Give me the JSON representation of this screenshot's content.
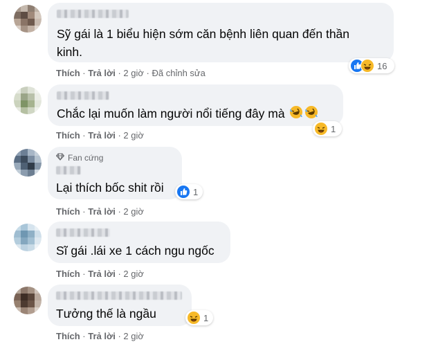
{
  "comments": [
    {
      "text_lines": [
        "Sỹ gái là 1 biểu hiện sớm căn bệnh liên quan đến thần",
        "kinh."
      ],
      "actions": {
        "like": "Thích",
        "reply": "Trả lời",
        "time": "2 giờ",
        "edited": "Đã chỉnh sửa"
      },
      "reactions": {
        "icons": [
          "like-icon",
          "haha-icon"
        ],
        "count": "16"
      }
    },
    {
      "text_lines": [
        "Chắc lại muốn làm người nổi tiếng đây mà"
      ],
      "inline_emojis": [
        "rofl-emoji",
        "rofl-emoji"
      ],
      "actions": {
        "like": "Thích",
        "reply": "Trả lời",
        "time": "2 giờ"
      },
      "reactions": {
        "icons": [
          "haha-icon"
        ],
        "count": "1"
      }
    },
    {
      "badge": "Fan cứng",
      "badge_icon": "diamond-icon",
      "text_lines": [
        "Lại thích bốc shit rồi"
      ],
      "actions": {
        "like": "Thích",
        "reply": "Trả lời",
        "time": "2 giờ"
      },
      "reactions": {
        "icons": [
          "like-icon"
        ],
        "count": "1"
      }
    },
    {
      "text_lines": [
        "Sĩ gái .lái xe 1 cách ngu ngốc"
      ],
      "actions": {
        "like": "Thích",
        "reply": "Trả lời",
        "time": "2 giờ"
      }
    },
    {
      "text_lines": [
        "Tưởng thế là ngầu"
      ],
      "actions": {
        "like": "Thích",
        "reply": "Trả lời",
        "time": "2 giờ"
      },
      "reactions": {
        "icons": [
          "haha-icon"
        ],
        "count": "1"
      }
    }
  ],
  "colors": {
    "bubble": "#f0f2f5",
    "meta_text": "#65676b",
    "like_blue": "#1877f2",
    "haha_yellow": "#f7b928"
  }
}
